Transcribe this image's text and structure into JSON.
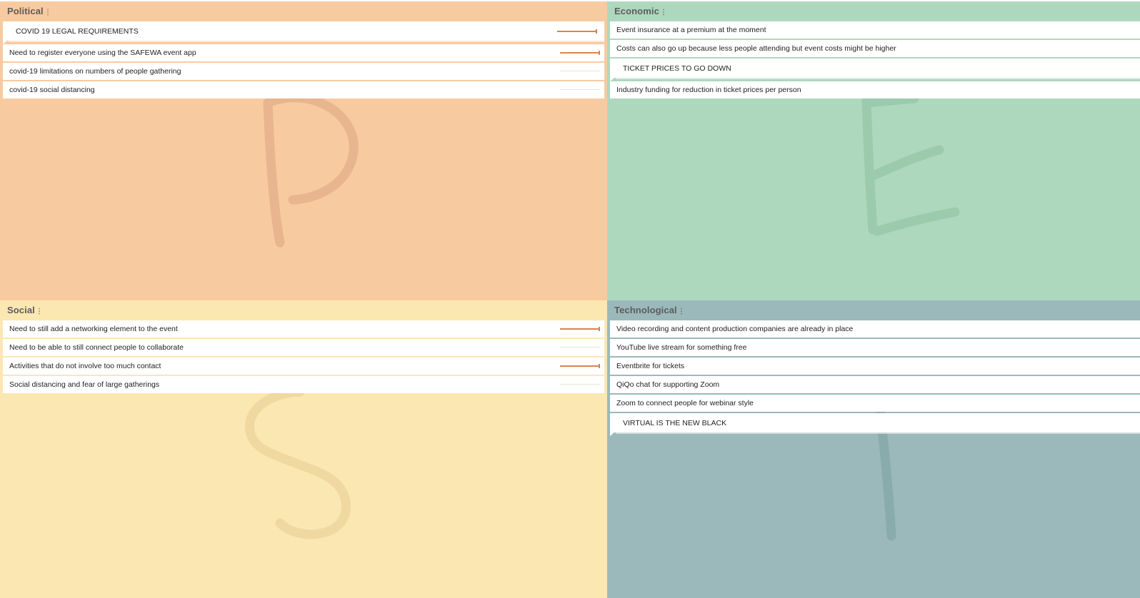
{
  "colors": {
    "political_bg": "#f8caa0",
    "economic_bg": "#aed8be",
    "social_bg": "#fbe7b2",
    "technological_bg": "#9bb9ba",
    "vote_accent": "#d9834f"
  },
  "quadrants": {
    "political": {
      "title": "Political",
      "watermark_letter": "P",
      "notes": [
        {
          "text": "COVID 19 LEGAL REQUIREMENTS",
          "heading": true,
          "votes": 1
        },
        {
          "text": "Need to register everyone using the SAFEWA event app",
          "heading": false,
          "votes": 1
        },
        {
          "text": "covid-19 limitations on numbers of people gathering",
          "heading": false,
          "votes": 0
        },
        {
          "text": "covid-19 social distancing",
          "heading": false,
          "votes": 0
        }
      ]
    },
    "economic": {
      "title": "Economic",
      "watermark_letter": "E",
      "notes": [
        {
          "text": "Event insurance at a premium at the moment",
          "heading": false
        },
        {
          "text": "Costs can also go up because less people attending but event costs might be higher",
          "heading": false
        },
        {
          "text": "TICKET PRICES TO GO DOWN",
          "heading": true
        },
        {
          "text": "Industry funding for reduction in ticket prices per person",
          "heading": false
        }
      ]
    },
    "social": {
      "title": "Social",
      "watermark_letter": "S",
      "notes": [
        {
          "text": "Need to still add a networking element to the event",
          "heading": false,
          "votes": 1
        },
        {
          "text": "Need to be able to still connect people to collaborate",
          "heading": false,
          "votes": 0
        },
        {
          "text": "Activities that do not involve too much contact",
          "heading": false,
          "votes": 1
        },
        {
          "text": "Social distancing and fear of large gatherings",
          "heading": false,
          "votes": 0
        }
      ]
    },
    "technological": {
      "title": "Technological",
      "watermark_letter": "T",
      "notes": [
        {
          "text": "Video recording and content production companies are already in place",
          "heading": false
        },
        {
          "text": "YouTube live stream for something free",
          "heading": false
        },
        {
          "text": "Eventbrite for tickets",
          "heading": false
        },
        {
          "text": "QiQo chat for supporting Zoom",
          "heading": false
        },
        {
          "text": "Zoom to connect people for webinar style",
          "heading": false
        },
        {
          "text": "VIRTUAL IS THE NEW BLACK",
          "heading": true
        }
      ]
    }
  },
  "icons": {
    "menu": "kebab-icon"
  }
}
